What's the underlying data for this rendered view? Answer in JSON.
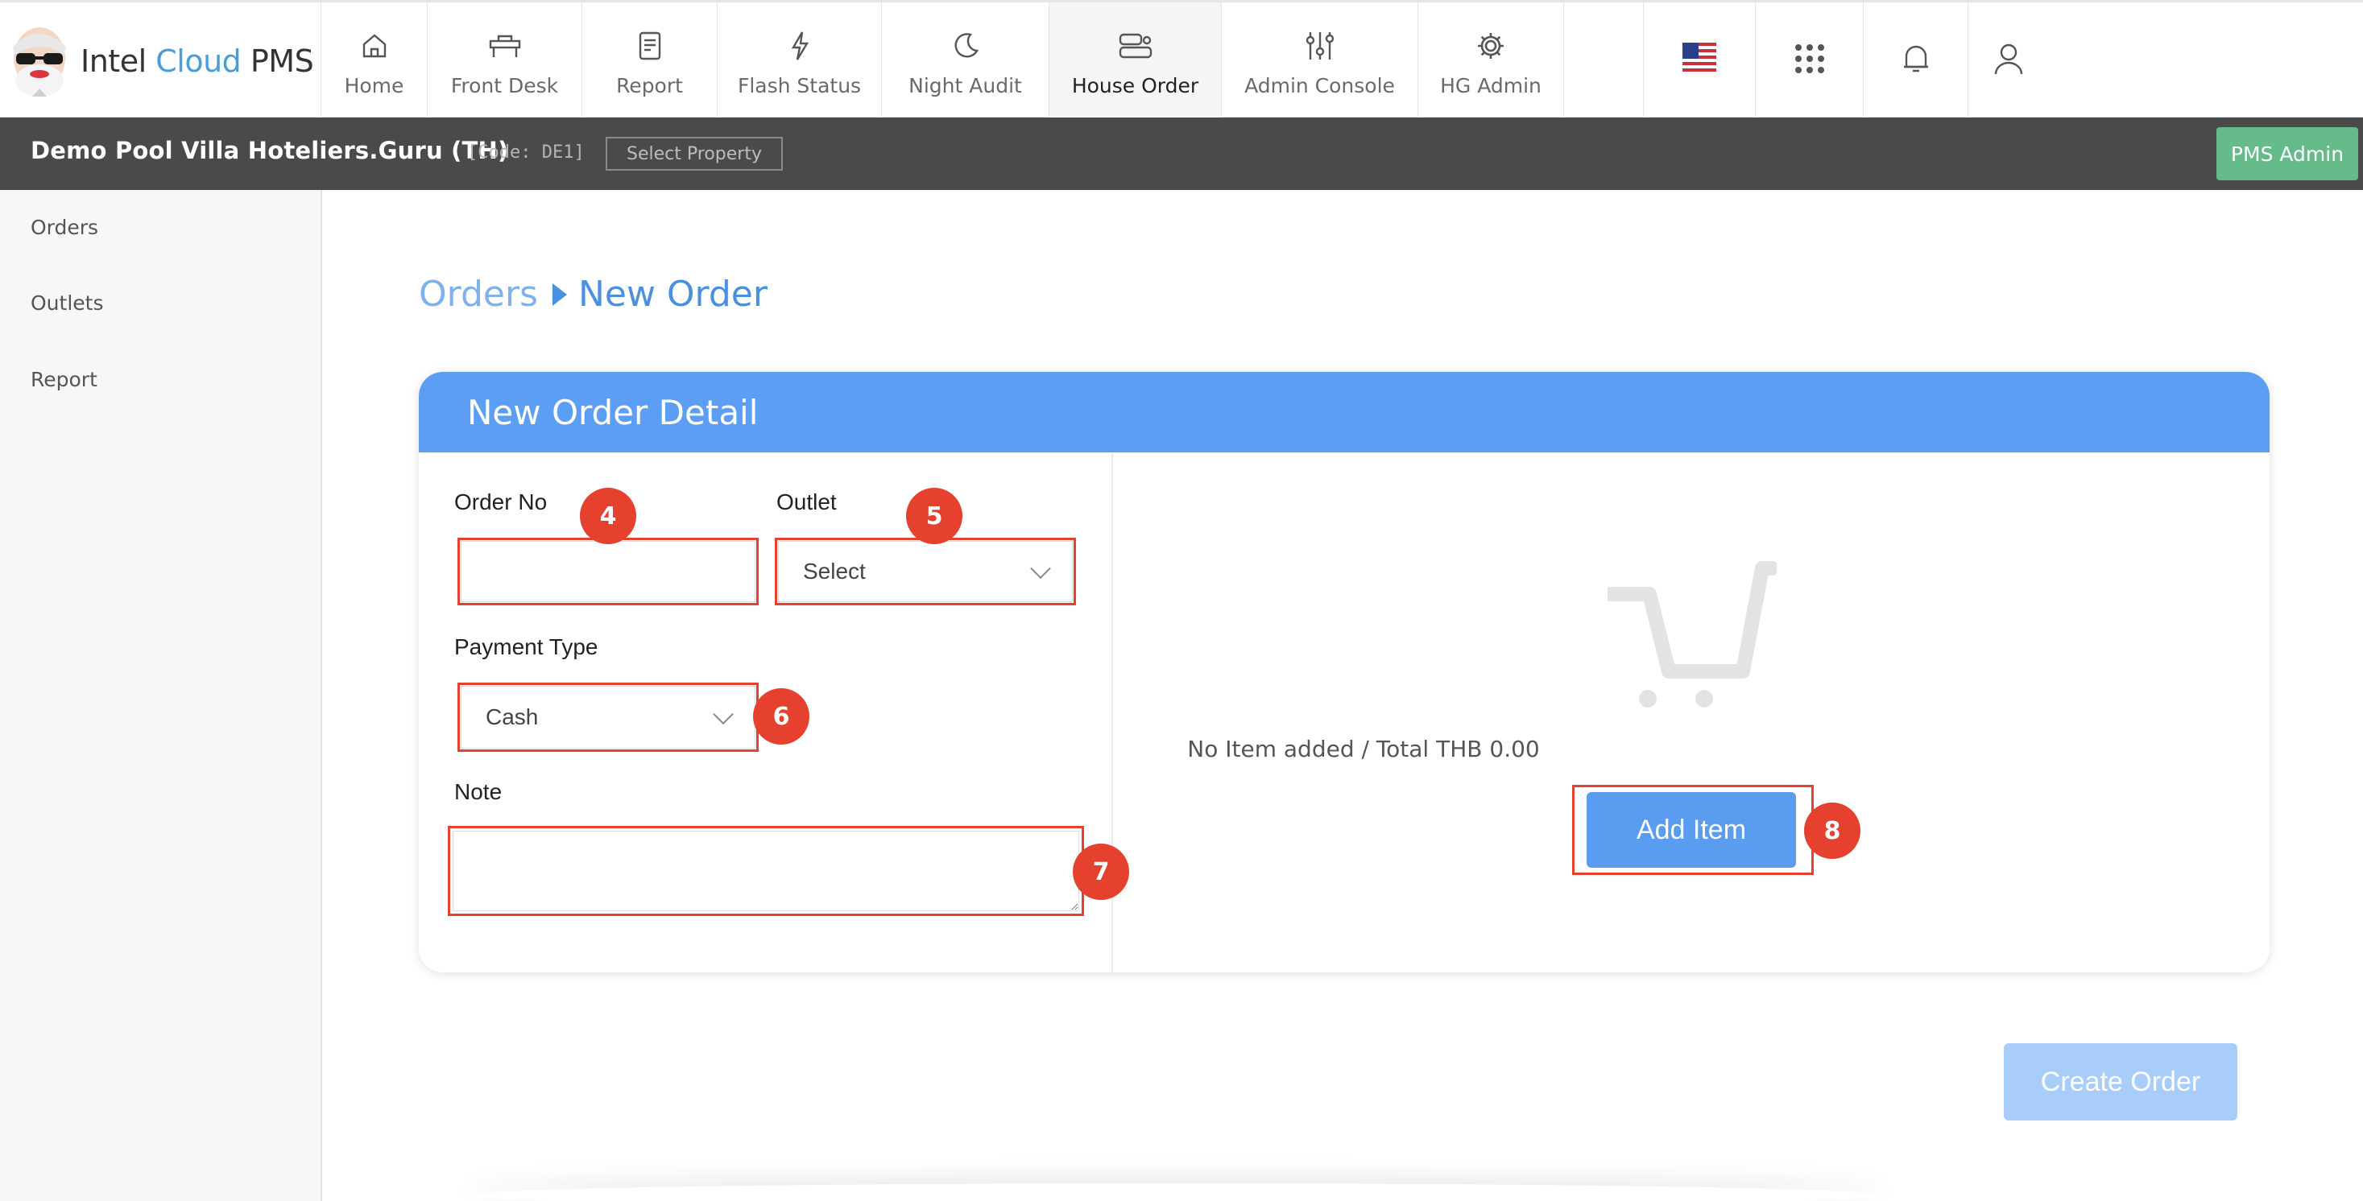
{
  "app": {
    "logo_intel": "Intel",
    "logo_cloud": "Cloud",
    "logo_pms": "PMS"
  },
  "nav": [
    {
      "label": "Home",
      "icon": "home-icon",
      "active": false
    },
    {
      "label": "Front Desk",
      "icon": "front-desk-icon",
      "active": false
    },
    {
      "label": "Report",
      "icon": "report-icon",
      "active": false
    },
    {
      "label": "Flash Status",
      "icon": "flash-icon",
      "active": false
    },
    {
      "label": "Night Audit",
      "icon": "moon-icon",
      "active": false
    },
    {
      "label": "House Order",
      "icon": "house-order-icon",
      "active": true
    },
    {
      "label": "Admin Console",
      "icon": "sliders-icon",
      "active": false
    },
    {
      "label": "HG Admin",
      "icon": "gear-icon",
      "active": false
    }
  ],
  "header_icons": [
    "us-flag-icon",
    "apps-grid-icon",
    "bell-icon",
    "user-icon"
  ],
  "property": {
    "name": "Demo Pool Villa Hoteliers.Guru (TH)",
    "code": "[Code: DE1]",
    "select_label": "Select Property",
    "admin_label": "PMS Admin"
  },
  "sidebar": {
    "items": [
      {
        "label": "Orders"
      },
      {
        "label": "Outlets"
      },
      {
        "label": "Report"
      }
    ]
  },
  "breadcrumb": {
    "root": "Orders",
    "current": "New Order"
  },
  "form": {
    "header": "New Order Detail",
    "order_no_label": "Order No",
    "order_no_value": "",
    "outlet_label": "Outlet",
    "outlet_value": "Select",
    "payment_label": "Payment Type",
    "payment_value": "Cash",
    "note_label": "Note",
    "note_value": ""
  },
  "cart": {
    "empty_text": "No Item added / Total THB 0.00",
    "add_item_label": "Add Item"
  },
  "create_order_label": "Create Order",
  "callouts": {
    "order_no": "4",
    "outlet": "5",
    "payment": "6",
    "note": "7",
    "add_item": "8"
  },
  "colors": {
    "accent": "#5b9ef4",
    "callout": "#e5412e",
    "admin_green": "#66bb8a",
    "propbar": "#4a4a4a"
  }
}
